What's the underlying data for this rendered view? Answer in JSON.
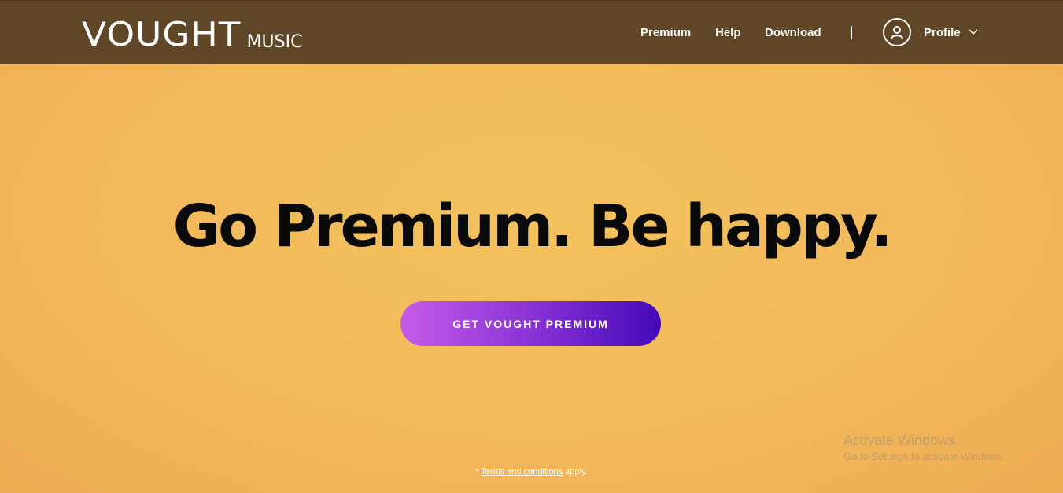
{
  "header": {
    "logo_main": "VOUGHT",
    "logo_sub": "MUSIC",
    "nav": {
      "premium": "Premium",
      "help": "Help",
      "download": "Download"
    },
    "profile_label": "Profile",
    "icons": {
      "avatar": "user-icon",
      "dropdown": "chevron-down-icon"
    }
  },
  "hero": {
    "headline": "Go Premium. Be happy.",
    "cta_label": "GET VOUGHT PREMIUM",
    "terms_prefix": "* ",
    "terms_link": "Terms and conditions",
    "terms_suffix": " apply."
  },
  "watermark": {
    "title": "Activate Windows",
    "subtitle": "Go to Settings to activate Windows."
  },
  "colors": {
    "header_bg": "#5e4627",
    "hero_bg": "#f2b85a",
    "cta_start": "#c65be9",
    "cta_end": "#4309b7",
    "headline": "#0a0a0a"
  }
}
